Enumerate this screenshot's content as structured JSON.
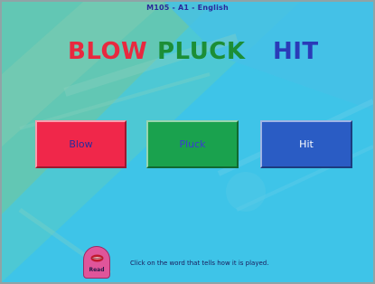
{
  "header": {
    "code": "M105 - A1 - English"
  },
  "titles": {
    "blow": "BLOW",
    "pluck": "PLUCK",
    "hit": "HIT"
  },
  "answer_buttons": {
    "blow": "Blow",
    "pluck": "Pluck",
    "hit": "Hit"
  },
  "read_button": {
    "label": "Read",
    "icon": "lips-icon"
  },
  "instruction": "Click on the word that tells how it is played.",
  "colors": {
    "background": "#38c3e6",
    "blow": "#f0274a",
    "pluck": "#1aa24e",
    "hit": "#2a5cc4",
    "read_button": "#e0559a"
  }
}
